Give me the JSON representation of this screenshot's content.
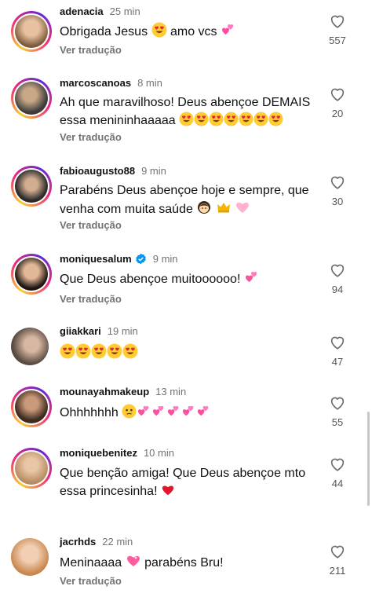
{
  "comments": [
    {
      "user": "adenacia",
      "time": "25 min",
      "text": "Obrigada Jesus",
      "text2": "amo vcs",
      "likes": "557",
      "translate": "Ver tradução"
    },
    {
      "user": "marcoscanoas",
      "time": "8 min",
      "text": "Ah que maravilhoso! Deus abençoe DEMAIS",
      "text2": "essa menininhaaaaa",
      "likes": "20",
      "translate": "Ver tradução"
    },
    {
      "user": "fabioaugusto88",
      "time": "9 min",
      "text": "Parabéns Deus abençoe hoje e sempre, que",
      "text2": "venha com muita saúde",
      "likes": "30",
      "translate": "Ver tradução"
    },
    {
      "user": "moniquesalum",
      "time": "9 min",
      "text": "Que Deus abençoe muitoooooo!",
      "likes": "94",
      "translate": "Ver tradução"
    },
    {
      "user": "giiakkari",
      "time": "19 min",
      "likes": "47"
    },
    {
      "user": "mounayahmakeup",
      "time": "13 min",
      "text": "Ohhhhhhh",
      "likes": "55"
    },
    {
      "user": "moniquebenitez",
      "time": "10 min",
      "text": "Que benção amiga! Que Deus abençoe mto",
      "text2": "essa princesinha!",
      "likes": "44"
    },
    {
      "user": "jacrhds",
      "time": "22 min",
      "text": "Meninaaaa",
      "text2": "parabéns Bru!",
      "likes": "211",
      "translate": "Ver tradução"
    }
  ],
  "icons": {
    "like": "heart-outline-icon",
    "verified": "verified-badge-icon"
  },
  "colors": {
    "verified": "#0095f6",
    "muted": "#737373"
  }
}
